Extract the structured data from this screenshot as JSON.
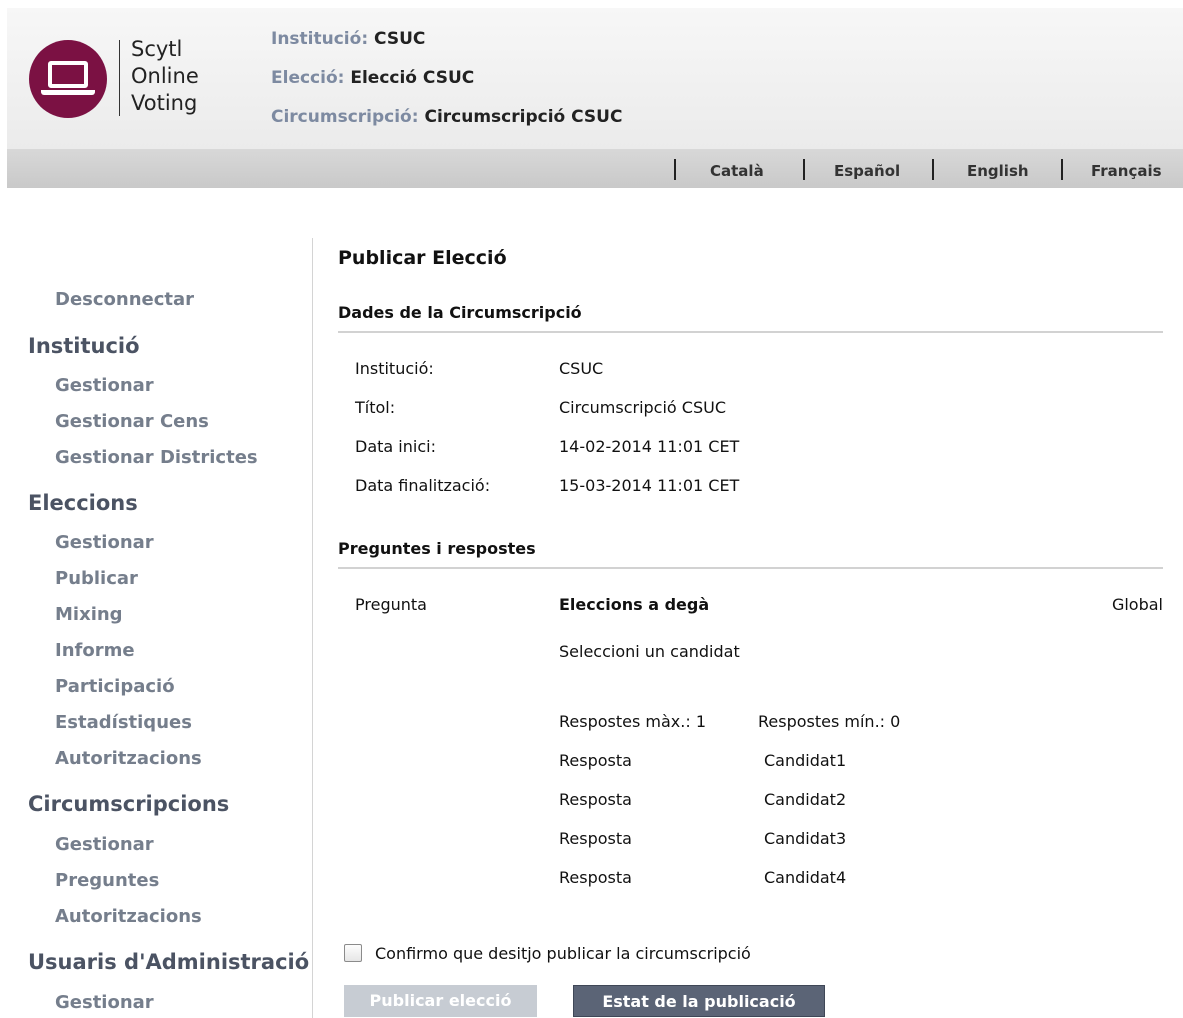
{
  "brand": {
    "line1": "Scytl",
    "line2": "Online",
    "line3": "Voting",
    "color": "#7b1143"
  },
  "header_info": {
    "institution_label": "Institució:",
    "institution_value": "CSUC",
    "election_label": "Elecció:",
    "election_value": "Elecció CSUC",
    "district_label": "Circumscripció:",
    "district_value": "Circumscripció CSUC"
  },
  "languages": [
    "Català",
    "Español",
    "English",
    "Français"
  ],
  "sidebar": {
    "logout": "Desconnectar",
    "sections": [
      {
        "title": "Institució",
        "items": [
          "Gestionar",
          "Gestionar Cens",
          "Gestionar Districtes"
        ]
      },
      {
        "title": "Eleccions",
        "items": [
          "Gestionar",
          "Publicar",
          "Mixing",
          "Informe",
          "Participació",
          "Estadístiques",
          "Autoritzacions"
        ]
      },
      {
        "title": "Circumscripcions",
        "items": [
          "Gestionar",
          "Preguntes",
          "Autoritzacions"
        ]
      },
      {
        "title": "Usuaris d'Administració",
        "items": [
          "Gestionar"
        ]
      }
    ]
  },
  "main": {
    "page_title": "Publicar Elecció",
    "district_section_title": "Dades de la Circumscripció",
    "district_fields": [
      {
        "label": "Institució:",
        "value": "CSUC"
      },
      {
        "label": "Títol:",
        "value": "Circumscripció CSUC"
      },
      {
        "label": "Data inici:",
        "value": "14-02-2014 11:01 CET"
      },
      {
        "label": "Data finalització:",
        "value": "15-03-2014 11:01 CET"
      }
    ],
    "questions_section_title": "Preguntes i respostes",
    "question": {
      "label": "Pregunta",
      "title": "Eleccions a degà",
      "scope": "Global",
      "description": "Seleccioni un candidat",
      "max_answers": "Respostes màx.: 1",
      "min_answers": "Respostes mín.: 0",
      "answers": [
        {
          "label": "Resposta",
          "value": "Candidat1"
        },
        {
          "label": "Resposta",
          "value": "Candidat2"
        },
        {
          "label": "Resposta",
          "value": "Candidat3"
        },
        {
          "label": "Resposta",
          "value": "Candidat4"
        }
      ]
    },
    "confirm_label": "Confirmo que desitjo publicar la circumscripció",
    "confirm_checked": false,
    "publish_button": "Publicar elecció",
    "status_button": "Estat de la publicació"
  }
}
